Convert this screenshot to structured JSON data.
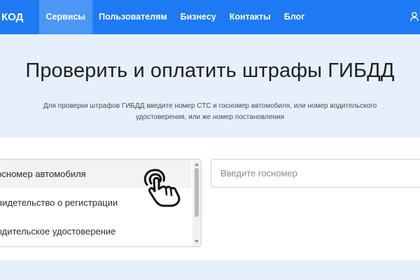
{
  "header": {
    "brand": "КОД",
    "nav": [
      {
        "label": "Сервисы",
        "active": true
      },
      {
        "label": "Пользователям",
        "active": false
      },
      {
        "label": "Бизнесу",
        "active": false
      },
      {
        "label": "Контакты",
        "active": false
      },
      {
        "label": "Блог",
        "active": false
      }
    ],
    "user_icon": "user-icon"
  },
  "hero": {
    "title": "Проверить и оплатить штрафы ГИБДД",
    "description": "Для проверки штрафов ГИБДД введите номер СТС и госномер автомобиля, или номер водительского удостоверения, или же номер постановления"
  },
  "search": {
    "options": [
      {
        "label": "Госномер автомобиля",
        "selected": true
      },
      {
        "label": "Свидетельство о регистрации",
        "selected": false
      },
      {
        "label": "Водительское удостоверение",
        "selected": false
      }
    ],
    "input_placeholder": "Введите госномер",
    "input_value": ""
  },
  "colors": {
    "nav_bg": "#1e7af2",
    "nav_active": "#4a97f6",
    "hero_bg": "#e6f0fc"
  },
  "cursor_icon": "pointing-hand-click-icon"
}
